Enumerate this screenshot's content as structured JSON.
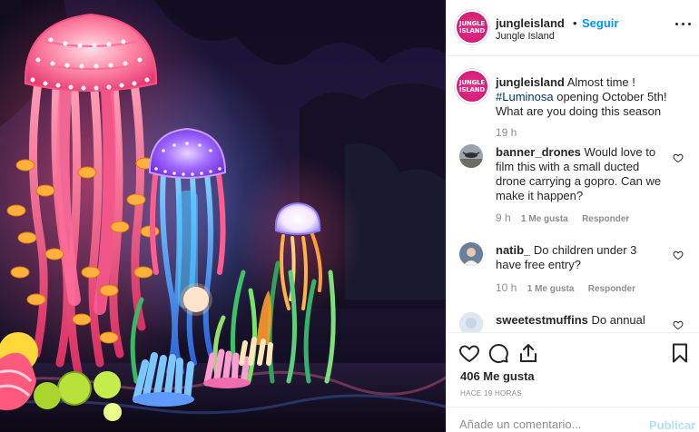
{
  "post": {
    "photo_alt": "Jellyfish lanterns at night",
    "author": {
      "username": "jungleisland",
      "location": "Jungle Island",
      "avatar_text": "JUNGLE ISLAND",
      "avatar_color": "#e0287f"
    },
    "separator": "•",
    "follow_label": "Seguir",
    "more_icon": "more-options-icon",
    "caption": {
      "username": "jungleisland",
      "text_before": "Almost time ! ",
      "hashtag": "#Luminosa",
      "text_after": " opening October 5th! What are you doing this season",
      "time": "19 h"
    },
    "comments": [
      {
        "username": "banner_drones",
        "text": "Would love to film this with a small ducted drone carrying a gopro. Can we make it happen?",
        "time": "9 h",
        "likes_label": "1 Me gusta",
        "reply_label": "Responder"
      },
      {
        "username": "natib_",
        "text": "Do children under 3 have free entry?",
        "time": "10 h",
        "likes_label": "1 Me gusta",
        "reply_label": "Responder"
      },
      {
        "username": "sweetestmuffins",
        "text": "Do annual passes",
        "time": "",
        "likes_label": "",
        "reply_label": ""
      }
    ],
    "actions": {
      "like_icon": "heart-icon",
      "comment_icon": "comment-icon",
      "share_icon": "share-icon",
      "save_icon": "bookmark-icon"
    },
    "likes_count": "406 Me gusta",
    "time_ago": "HACE 19 HORAS",
    "comment_input": {
      "placeholder": "Añade un comentario...",
      "publish_label": "Publicar"
    },
    "colors": {
      "link_blue": "#0095f6",
      "hashtag": "#00376b",
      "muted": "#8e8e8e",
      "publish_disabled": "#b2dffc"
    }
  }
}
